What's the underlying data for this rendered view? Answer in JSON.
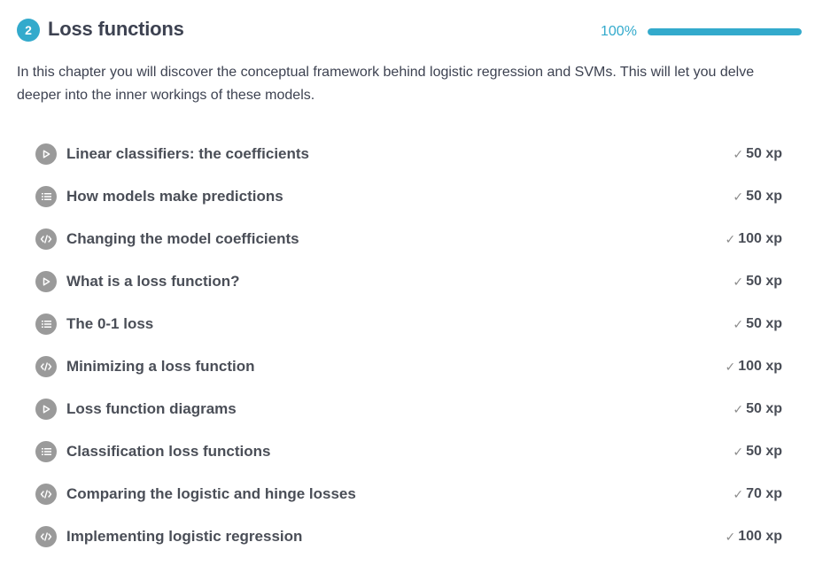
{
  "chapter": {
    "number": "2",
    "title": "Loss functions",
    "progress_text": "100%",
    "progress_fraction": 1.0,
    "accent_color": "#33aacc",
    "description": "In this chapter you will discover the conceptual framework behind logistic regression and SVMs. This will let you delve deeper into the inner workings of these models."
  },
  "exercises": [
    {
      "icon": "video",
      "title": "Linear classifiers: the coefficients",
      "xp": "50 xp"
    },
    {
      "icon": "multiple-choice",
      "title": "How models make predictions",
      "xp": "50 xp"
    },
    {
      "icon": "code",
      "title": "Changing the model coefficients",
      "xp": "100 xp"
    },
    {
      "icon": "video",
      "title": "What is a loss function?",
      "xp": "50 xp"
    },
    {
      "icon": "multiple-choice",
      "title": "The 0-1 loss",
      "xp": "50 xp"
    },
    {
      "icon": "code",
      "title": "Minimizing a loss function",
      "xp": "100 xp"
    },
    {
      "icon": "video",
      "title": "Loss function diagrams",
      "xp": "50 xp"
    },
    {
      "icon": "multiple-choice",
      "title": "Classification loss functions",
      "xp": "50 xp"
    },
    {
      "icon": "code",
      "title": "Comparing the logistic and hinge losses",
      "xp": "70 xp"
    },
    {
      "icon": "code",
      "title": "Implementing logistic regression",
      "xp": "100 xp"
    }
  ]
}
